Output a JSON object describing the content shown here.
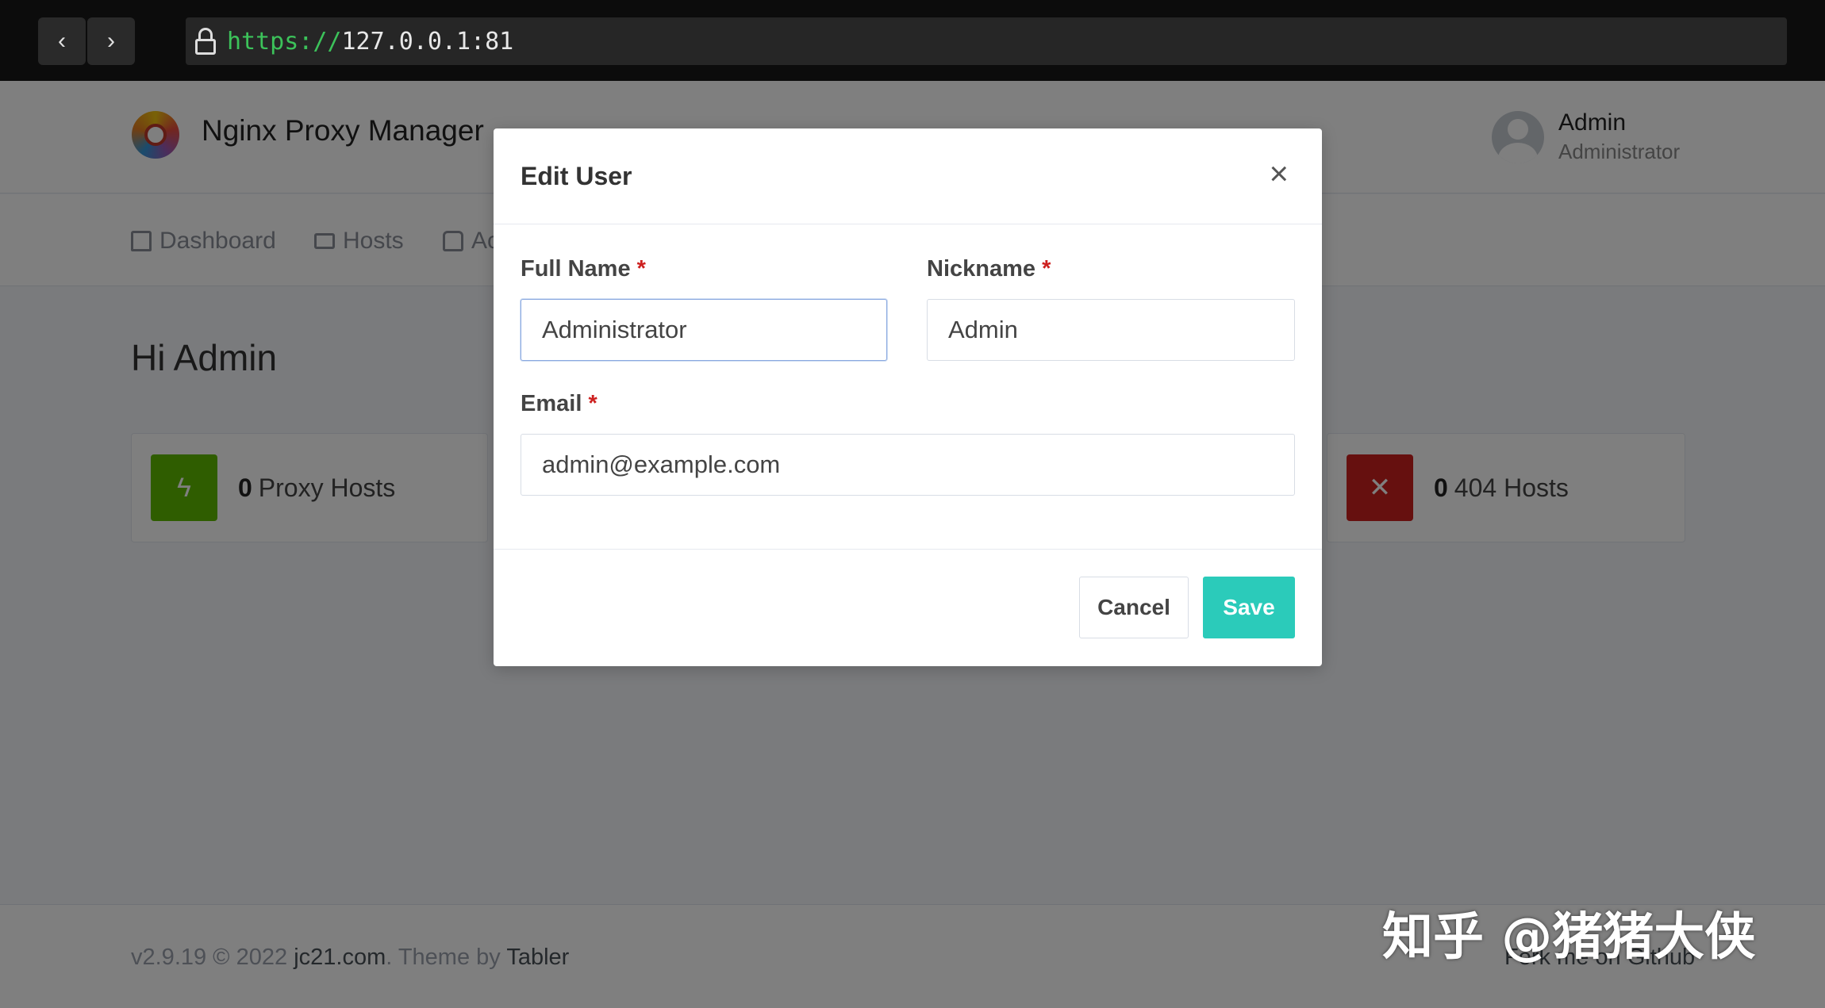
{
  "browser": {
    "url_scheme": "https://",
    "url_host": "127.0.0.1:81",
    "back_icon": "chevron-left-icon",
    "forward_icon": "chevron-right-icon"
  },
  "header": {
    "brand": "Nginx Proxy Manager",
    "user_name": "Admin",
    "user_role": "Administrator"
  },
  "nav": {
    "items": [
      {
        "label": "Dashboard",
        "icon": "home-icon"
      },
      {
        "label": "Hosts",
        "icon": "monitor-icon"
      },
      {
        "label": "Ac",
        "icon": "lock-icon"
      }
    ]
  },
  "main": {
    "greeting": "Hi Admin",
    "stats": [
      {
        "count": "0",
        "label": "Proxy Hosts",
        "color": "#5eba00",
        "icon": "zap-icon"
      },
      {
        "count": "0",
        "label": "404 Hosts",
        "color": "#cd201f",
        "icon": "zap-off-icon"
      }
    ]
  },
  "footer": {
    "version": "v2.9.19 © 2022",
    "site_link": "jc21.com",
    "theme_text": ". Theme by",
    "theme_link": "Tabler",
    "fork_text": "Fork me on Github"
  },
  "modal": {
    "title": "Edit User",
    "close_icon": "close-icon",
    "full_name_label": "Full Name",
    "full_name_value": "Administrator",
    "nickname_label": "Nickname",
    "nickname_value": "Admin",
    "email_label": "Email",
    "email_value": "admin@example.com",
    "required_mark": "*",
    "cancel_label": "Cancel",
    "save_label": "Save",
    "save_color": "#2bcbba"
  },
  "watermark": "知乎 @猪猪大侠"
}
